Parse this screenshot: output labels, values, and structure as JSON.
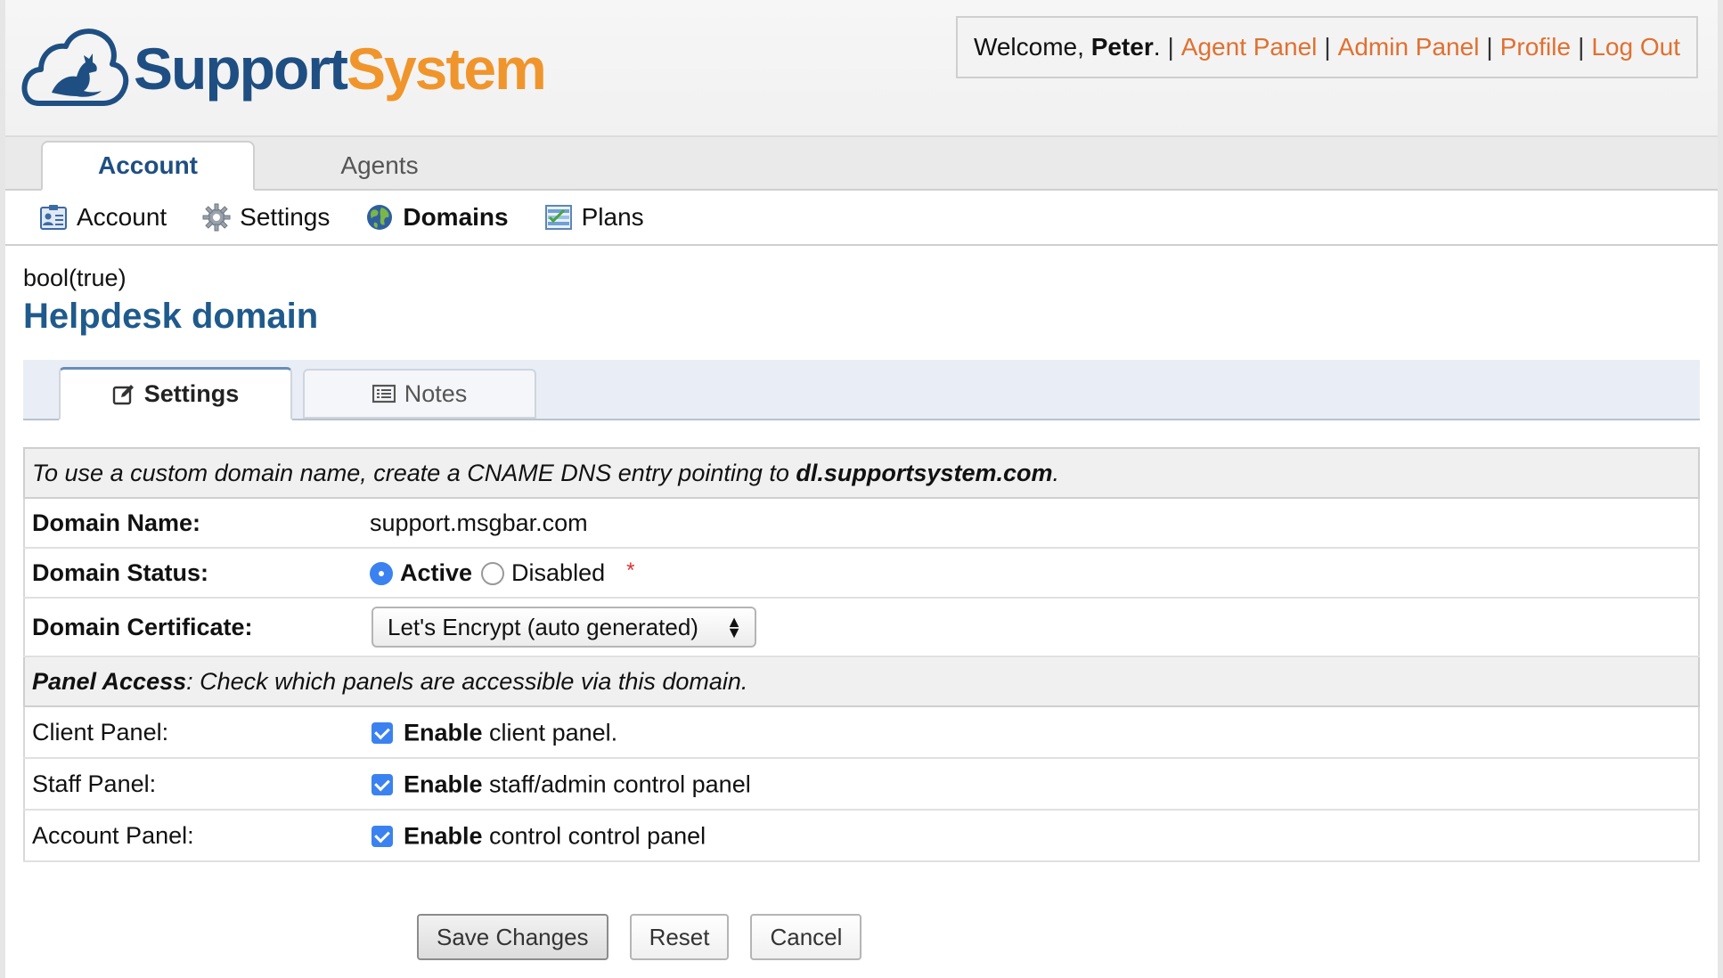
{
  "header": {
    "logo": {
      "part1": "Support",
      "part2": "System"
    },
    "welcome": {
      "prefix": "Welcome, ",
      "name": "Peter",
      "suffix": ".",
      "links": [
        "Agent Panel",
        "Admin Panel",
        "Profile",
        "Log Out"
      ]
    }
  },
  "main_tabs": [
    "Account",
    "Agents"
  ],
  "sub_nav": [
    "Account",
    "Settings",
    "Domains",
    "Plans"
  ],
  "content": {
    "debug": "bool(true)",
    "title": "Helpdesk domain",
    "tabs": [
      "Settings",
      "Notes"
    ]
  },
  "form": {
    "info": {
      "prefix": "To use a custom domain name, create a CNAME DNS entry pointing to ",
      "host": "dl.supportsystem.com",
      "suffix": "."
    },
    "domain_name": {
      "label": "Domain Name:",
      "value": "support.msgbar.com"
    },
    "domain_status": {
      "label": "Domain Status:",
      "options": [
        "Active",
        "Disabled"
      ],
      "selected": "Active",
      "required_mark": "*"
    },
    "domain_certificate": {
      "label": "Domain Certificate:",
      "selected": "Let's Encrypt (auto generated)"
    },
    "panel_access": {
      "title": "Panel Access",
      "description": ": Check which panels are accessible via this domain."
    },
    "client_panel": {
      "label": "Client Panel:",
      "bold": "Enable",
      "text": " client panel."
    },
    "staff_panel": {
      "label": "Staff Panel:",
      "bold": "Enable",
      "text": " staff/admin control panel"
    },
    "account_panel": {
      "label": "Account Panel:",
      "bold": "Enable",
      "text": " control control panel"
    }
  },
  "buttons": [
    "Save Changes",
    "Reset",
    "Cancel"
  ],
  "colors": {
    "brand_blue": "#1f4f82",
    "brand_orange": "#f0952c",
    "link_orange": "#e07030",
    "title_blue": "#1f5a8c",
    "check_blue": "#3b82f0"
  }
}
